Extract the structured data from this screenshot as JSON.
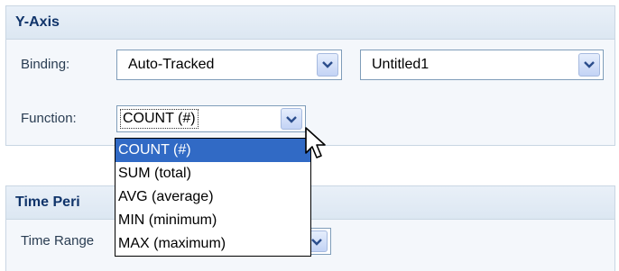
{
  "y_axis": {
    "title": "Y-Axis",
    "binding_label": "Binding:",
    "binding_value": "Auto-Tracked",
    "series_value": "Untitled1",
    "function_label": "Function:",
    "function_value": "COUNT (#)",
    "function_options": [
      "COUNT (#)",
      "SUM (total)",
      "AVG (average)",
      "MIN (minimum)",
      "MAX (maximum)"
    ],
    "selected_option_index": 0
  },
  "time_period": {
    "title": "Time Peri",
    "time_range_label": "Time Range"
  },
  "colors": {
    "header_text": "#10346a",
    "selected_item": "#316ac5",
    "panel_border": "#c9d6e3"
  },
  "icons": [
    "chevron-down-icon",
    "mouse-pointer-icon"
  ]
}
